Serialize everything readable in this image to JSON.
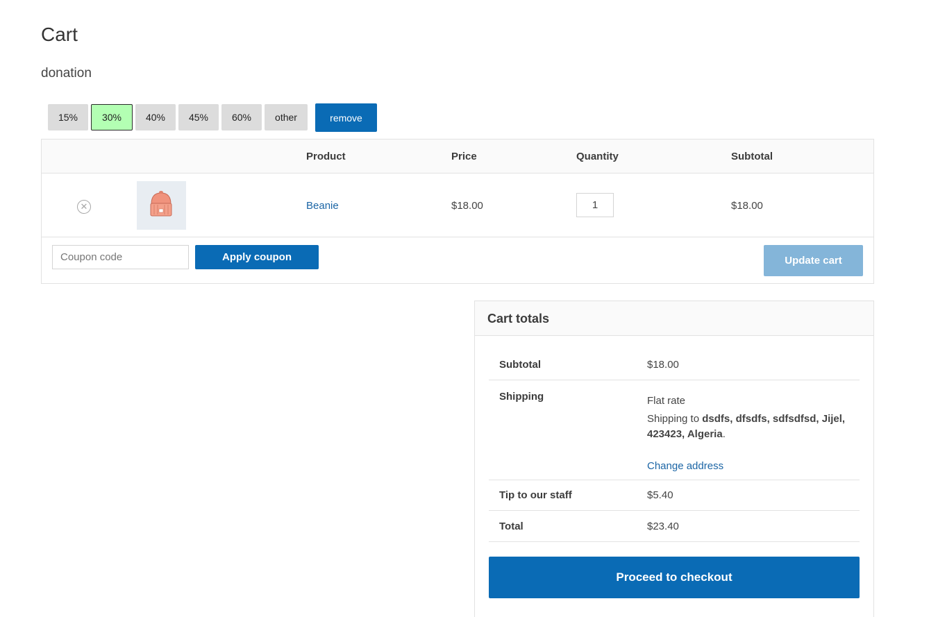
{
  "page": {
    "title": "Cart",
    "donation_label": "donation"
  },
  "tips": {
    "options": [
      "15%",
      "30%",
      "40%",
      "45%",
      "60%",
      "other"
    ],
    "selected": "30%",
    "remove_label": "remove",
    "selected_color": "#b3ffb3"
  },
  "cart_table": {
    "headers": {
      "product": "Product",
      "price": "Price",
      "quantity": "Quantity",
      "subtotal": "Subtotal"
    },
    "items": [
      {
        "remove_icon": "close-circle-icon",
        "thumbnail": "beanie-hat-icon",
        "name": "Beanie",
        "price": "$18.00",
        "quantity": "1",
        "subtotal": "$18.00"
      }
    ],
    "coupon_placeholder": "Coupon code",
    "apply_coupon_label": "Apply coupon",
    "update_cart_label": "Update cart"
  },
  "cart_totals": {
    "title": "Cart totals",
    "subtotal_label": "Subtotal",
    "subtotal_value": "$18.00",
    "shipping_label": "Shipping",
    "shipping_method": "Flat rate",
    "shipping_to_prefix": "Shipping to ",
    "shipping_destination": "dsdfs, dfsdfs, sdfsdfsd, Jijel, 423423, Algeria",
    "shipping_suffix": ".",
    "change_address_label": "Change address",
    "tip_label": "Tip to our staff",
    "tip_value": "$5.40",
    "total_label": "Total",
    "total_value": "$23.40",
    "checkout_label": "Proceed to checkout"
  },
  "colors": {
    "primary": "#0a6bb5",
    "primary_disabled": "#84b5d9",
    "link": "#1b65a5"
  }
}
